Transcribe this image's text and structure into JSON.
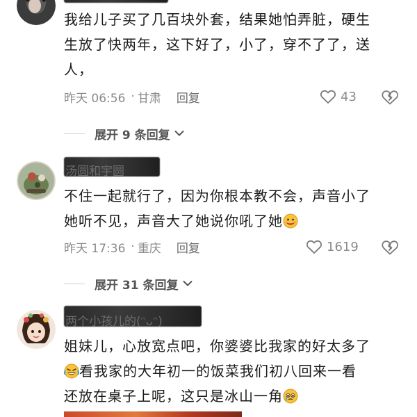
{
  "comments": [
    {
      "username": "",
      "text": "我给儿子买了几百块外套，结果她怕弄脏，硬生生放了快两年，这下好了，小了，穿不了了，送人，",
      "lines": [
        "我给儿子买了几百块外套，结果她怕弄脏，硬生",
        "生放了快两年，这下好了，小了，穿不了了，送",
        "人，"
      ],
      "time": "昨天 06:56",
      "location": "甘肃",
      "reply_label": "回复",
      "likes": "43",
      "expand_label": "展开 9 条回复"
    },
    {
      "username": "汤圆和宇圆",
      "lines": [
        "不住一起就行了，因为你根本教不会，声音小了",
        "她听不见，声音大了她说你吼了她"
      ],
      "time": "昨天 17:36",
      "location": "重庆",
      "reply_label": "回复",
      "likes": "1619",
      "expand_label": "展开 31 条回复"
    },
    {
      "username": "两个小孩儿的(ᵔᴗᵔ)",
      "lines": [
        "姐妹儿，心放宽点吧，你婆婆比我家的好太多了",
        "看我家的大年初一的饭菜我们初八回来一看",
        "还放在桌子上呢，这只是冰山一角"
      ]
    }
  ],
  "icons": {
    "like": "heart-outline-icon",
    "dislike": "broken-heart-icon",
    "expand": "chevron-down-icon",
    "emoji_hot": "hot-face-emoji",
    "emoji_laugh": "laughing-crying-emoji",
    "emoji_cry": "pleading-face-emoji"
  },
  "colors": {
    "text": "#1a1a1a",
    "meta": "#8a8a8a",
    "expand": "#555555"
  }
}
